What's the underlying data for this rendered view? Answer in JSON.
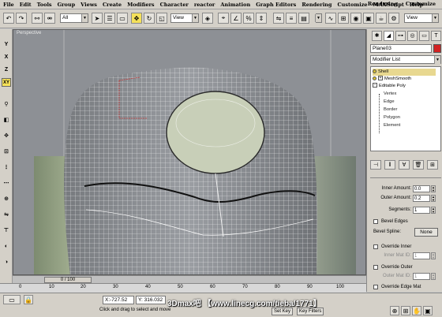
{
  "menubar": {
    "items": [
      "File",
      "Edit",
      "Tools",
      "Group",
      "Views",
      "Create",
      "Modifiers",
      "Character",
      "reactor",
      "Animation",
      "Graph Editors",
      "Rendering",
      "Customize",
      "MAXScript",
      "Help"
    ],
    "right_items": [
      "Rendering",
      "Customize"
    ]
  },
  "toolbar": {
    "selection_filter": "All",
    "ref_coord": "View",
    "named_selection": "View"
  },
  "left_tools": [
    "Y",
    "X",
    "Z",
    "XY"
  ],
  "viewport": {
    "label": "Perspective"
  },
  "command_panel": {
    "object_name": "Plane03",
    "object_color": "#d22222",
    "modifier_list_label": "Modifier List",
    "stack": {
      "shell": "Shell",
      "meshsmooth": "MeshSmooth",
      "editable_poly": "Editable Poly",
      "vertex": "Vertex",
      "edge": "Edge",
      "border": "Border",
      "polygon": "Polygon",
      "element": "Element"
    },
    "params": {
      "inner_amount_label": "Inner Amount:",
      "inner_amount_value": "0.0",
      "outer_amount_label": "Outer Amount:",
      "outer_amount_value": "0.2",
      "segments_label": "Segments:",
      "segments_value": "1",
      "bevel_edges_label": "Bevel Edges",
      "bevel_spline_label": "Bevel Spline:",
      "bevel_spline_value": "None",
      "override_inner_label": "Override Inner",
      "inner_mat_id_label": "Inner Mat ID:",
      "inner_mat_id_value": "1",
      "override_outer_label": "Override Outer",
      "outer_mat_id_label": "Outer Mat ID:",
      "outer_mat_id_value": "1",
      "override_edge_label": "Override Edge Mat"
    }
  },
  "timeline": {
    "frame_display": "0 / 100",
    "ruler_ticks": [
      "0",
      "10",
      "20",
      "30",
      "40",
      "50",
      "60",
      "70",
      "80",
      "90",
      "100"
    ]
  },
  "statusbar": {
    "x_value": "X:-727.52",
    "y_value": "Y: 316.032",
    "status_text": "Click and drag to select and move",
    "set_key": "Set Key",
    "key_filters": "Key Filters",
    "watermark": "3Dmax吧 【www.linecg.com/tieba/1771】"
  }
}
